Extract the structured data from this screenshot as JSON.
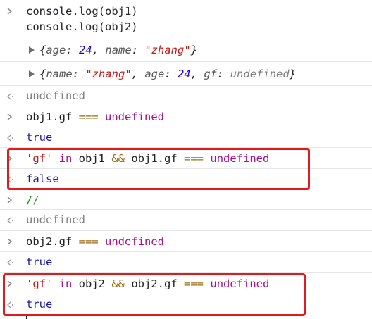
{
  "console": {
    "entries": [
      {
        "kind": "input",
        "lines": [
          "console.log(obj1)",
          "console.log(obj2)"
        ]
      },
      {
        "kind": "log-object",
        "parts": [
          "{",
          "age",
          ": ",
          "24",
          ", ",
          "name",
          ": ",
          "\"zhang\"",
          "}"
        ]
      },
      {
        "kind": "log-object",
        "parts": [
          "{",
          "name",
          ": ",
          "\"zhang\"",
          ", ",
          "age",
          ": ",
          "24",
          ", ",
          "gf",
          ": ",
          "undefined",
          "}"
        ]
      },
      {
        "kind": "result",
        "text": "undefined"
      },
      {
        "kind": "input",
        "parts": [
          "obj1.gf ",
          "===",
          " ",
          "undefined"
        ]
      },
      {
        "kind": "result",
        "text": "true"
      },
      {
        "kind": "input",
        "parts": [
          "'gf'",
          " ",
          "in",
          " obj1 ",
          "&&",
          " obj1.gf ",
          "===",
          " ",
          "undefined"
        ]
      },
      {
        "kind": "result",
        "text": "false"
      },
      {
        "kind": "input",
        "parts": [
          "//"
        ]
      },
      {
        "kind": "result",
        "text": "undefined"
      },
      {
        "kind": "input",
        "parts": [
          "obj2.gf ",
          "===",
          " ",
          "undefined"
        ]
      },
      {
        "kind": "result",
        "text": "true"
      },
      {
        "kind": "input",
        "parts": [
          "'gf'",
          " ",
          "in",
          " obj2 ",
          "&&",
          " obj2.gf ",
          "===",
          " ",
          "undefined"
        ]
      },
      {
        "kind": "result",
        "text": "true"
      }
    ]
  },
  "colors": {
    "highlight": "#e11b1b",
    "keyword": "#aa0d91",
    "string": "#c41a16",
    "number": "#1c00cf",
    "boolean": "#1a1aa6",
    "comment": "#1e8a1e"
  },
  "icons": {
    "prompt": "chevron-right-icon",
    "result": "return-arrow-icon",
    "expand": "disclosure-triangle-icon"
  }
}
